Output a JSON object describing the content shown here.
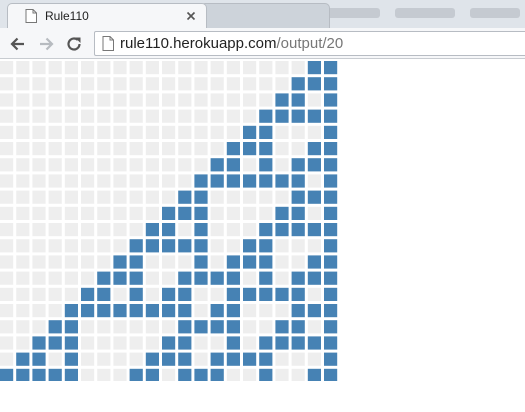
{
  "browser": {
    "tabs": [
      {
        "title": "Rule110",
        "active": true
      },
      {
        "title": "",
        "active": false
      }
    ],
    "toolbar": {
      "url_host": "rule110.herokuapp.com",
      "url_path": "/output/20"
    }
  },
  "icons": {
    "tab": "page-icon",
    "tab_close": "close-icon",
    "back": "back-arrow-icon",
    "forward": "forward-arrow-icon",
    "reload": "reload-icon",
    "omnibox": "page-icon"
  },
  "colors": {
    "cell_on": "#4682b4",
    "cell_off": "#eeeeee",
    "tab_strip": "#dfe4ea"
  },
  "automaton": {
    "rule": 110,
    "rows": [
      "000000000000000000011",
      "000000000000000000111",
      "000000000000000001101",
      "000000000000000011111",
      "000000000000000110001",
      "000000000000001110011",
      "000000000000011010111",
      "000000000000111111101",
      "000000000001100000111",
      "000000000011100001101",
      "000000000110100011111",
      "000000001111100110001",
      "000000011000101110011",
      "000000111001111010111",
      "000001101011001111101",
      "000011111111011000111",
      "000110000001111001101",
      "001110000011001011111",
      "011010000111011110001",
      "111110001101110010011"
    ]
  }
}
